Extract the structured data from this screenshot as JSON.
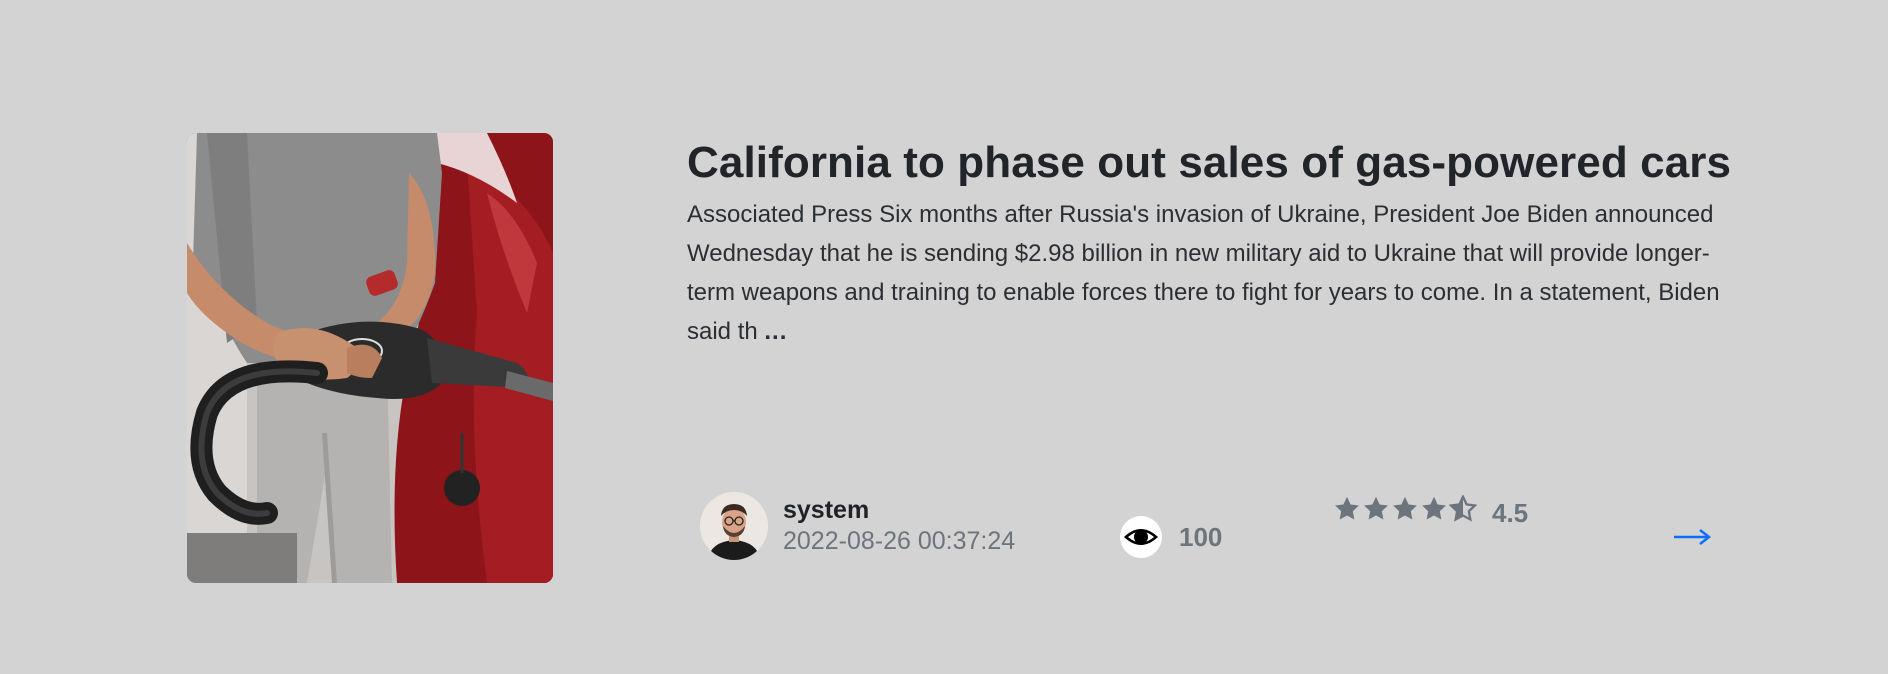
{
  "article": {
    "title": "California to phase out sales of gas-powered cars",
    "excerpt": "Associated Press Six months after Russia's invasion of Ukraine, President Joe Biden announced Wednesday that he is sending $2.98 billion in new military aid to Ukraine that will provide longer-term weapons and training to enable forces there to fight for years to come. In a statement, Biden said th",
    "more_label": "...",
    "image_icon": "gas-pump-photo"
  },
  "author": {
    "name": "system",
    "date": "2022-08-26 00:37:24",
    "avatar_icon": "user-avatar"
  },
  "stats": {
    "views": "100",
    "views_icon": "eye-icon",
    "rating": "4.5",
    "rating_value": 4.5,
    "rating_max": 5
  },
  "actions": {
    "read_more_icon": "arrow-right-icon"
  },
  "colors": {
    "background": "#d3d3d3",
    "muted": "#6c757d",
    "accent": "#0d6efd",
    "title": "#212529"
  }
}
